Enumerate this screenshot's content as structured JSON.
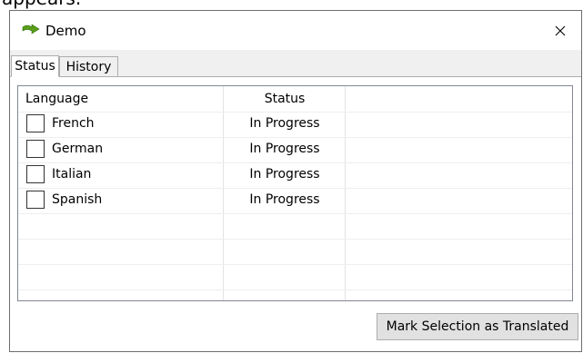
{
  "clipped_text": "appears.",
  "window": {
    "title": "Demo"
  },
  "tabs": [
    {
      "label": "Status",
      "active": true
    },
    {
      "label": "History",
      "active": false
    }
  ],
  "grid": {
    "columns": [
      "Language",
      "Status"
    ],
    "rows": [
      {
        "language": "French",
        "status": "In Progress",
        "checked": false
      },
      {
        "language": "German",
        "status": "In Progress",
        "checked": false
      },
      {
        "language": "Italian",
        "status": "In Progress",
        "checked": false
      },
      {
        "language": "Spanish",
        "status": "In Progress",
        "checked": false
      }
    ]
  },
  "actions": {
    "mark_translated": "Mark Selection as Translated"
  },
  "colors": {
    "window_bg": "#f0f0f0",
    "border": "#adadad",
    "icon_green": "#5a9e1a"
  }
}
